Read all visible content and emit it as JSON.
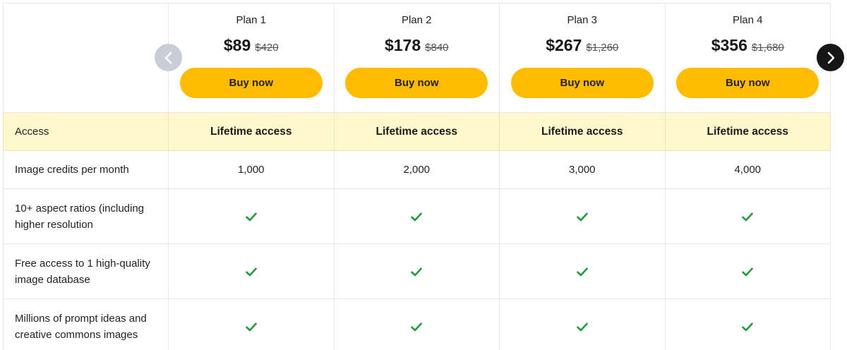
{
  "plans": [
    {
      "name": "Plan 1",
      "price": "$89",
      "old_price": "$420",
      "button": "Buy now",
      "access": "Lifetime access",
      "credits": "1,000"
    },
    {
      "name": "Plan 2",
      "price": "$178",
      "old_price": "$840",
      "button": "Buy now",
      "access": "Lifetime access",
      "credits": "2,000"
    },
    {
      "name": "Plan 3",
      "price": "$267",
      "old_price": "$1,260",
      "button": "Buy now",
      "access": "Lifetime access",
      "credits": "3,000"
    },
    {
      "name": "Plan 4",
      "price": "$356",
      "old_price": "$1,680",
      "button": "Buy now",
      "access": "Lifetime access",
      "credits": "4,000"
    }
  ],
  "rows": {
    "access_label": "Access",
    "credits_label": "Image credits per month",
    "features": [
      {
        "label": "10+ aspect ratios (including higher resolution",
        "included": [
          true,
          true,
          true,
          true
        ]
      },
      {
        "label": "Free access to 1 high-quality image database",
        "included": [
          true,
          true,
          true,
          true
        ]
      },
      {
        "label": "Millions of prompt ideas and creative commons images",
        "included": [
          true,
          true,
          true,
          true
        ]
      }
    ]
  },
  "icons": {
    "check": "check-icon",
    "prev": "chevron-left-icon",
    "next": "chevron-right-icon"
  },
  "colors": {
    "button": "#ffbb00",
    "access_row": "#fff8cc",
    "check": "#1e9c3a",
    "nav_prev": "#c9ced6",
    "nav_next": "#161616"
  }
}
